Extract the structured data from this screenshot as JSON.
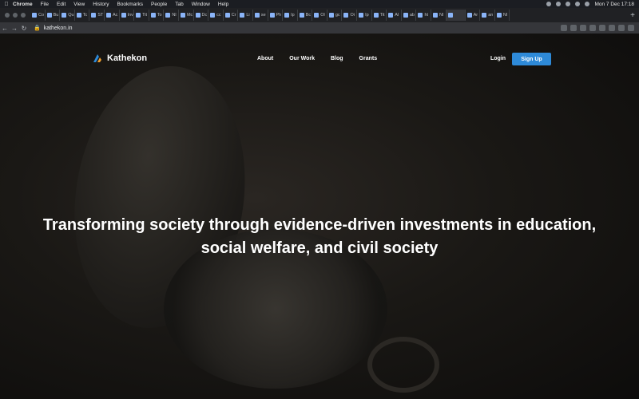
{
  "menubar": {
    "app": "Chrome",
    "items": [
      "File",
      "Edit",
      "View",
      "History",
      "Bookmarks",
      "People",
      "Tab",
      "Window",
      "Help"
    ],
    "datetime": "Mon 7 Dec  17:18"
  },
  "tabs": [
    "Co",
    "Bu",
    "Qu",
    "Tc",
    "ST",
    "Ac",
    "Inv",
    "Tit",
    "To",
    "Nl",
    "Mc",
    "Dc",
    "cc",
    "Cr",
    "Li",
    "se",
    "Ph",
    "Ip",
    "Bc",
    "Ol",
    "gc",
    "Oi",
    "Ip",
    "Tit",
    "Al",
    "ab",
    "ht",
    "Nl",
    "",
    "Ar",
    "an",
    "Nl"
  ],
  "toolbar": {
    "url": "kathekon.in"
  },
  "site": {
    "logo": "Kathekon",
    "nav": [
      "About",
      "Our Work",
      "Blog",
      "Grants"
    ],
    "login": "Login",
    "signup": "Sign Up",
    "hero_line1": "Transforming society through evidence-driven investments in education,",
    "hero_line2": "social welfare, and civil society",
    "accent_color": "#2e8ad8"
  }
}
